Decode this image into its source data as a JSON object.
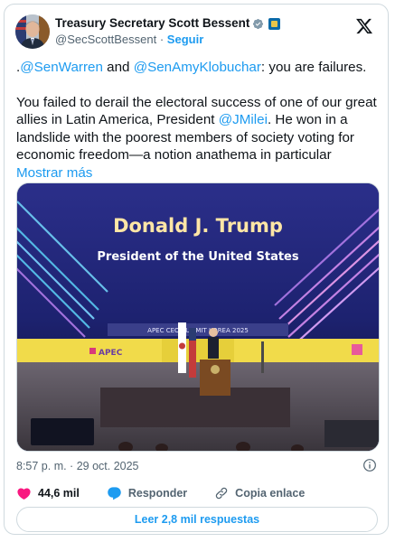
{
  "author": {
    "name": "Treasury Secretary Scott Bessent",
    "handle": "@SecScottBessent",
    "separator": "·",
    "follow_label": "Seguir",
    "verified_color": "#829aab",
    "flag_badge_color": "#0b6aa8"
  },
  "tweet": {
    "line1_prefix": ".",
    "mention1": "@SenWarren",
    "and_text": " and ",
    "mention2": "@SenAmyKlobuchar",
    "line1_suffix": ": you are failures.",
    "para2_text1": "You failed to derail the electoral success of one of our great allies in Latin America, President ",
    "mention3": "@JMilei",
    "para2_text2": ". He won in a landslide with the poorest members of society voting for economic freedom—a notion anathema in particular ",
    "show_more": "Mostrar más"
  },
  "media": {
    "banner_title": "Donald J. Trump",
    "banner_subtitle": "President of the United States",
    "stage_sign": "APEC CEO SUMMIT KOREA 2025",
    "logo_text": "APEC"
  },
  "meta": {
    "timestamp": "8:57 p. m. · 29 oct. 2025"
  },
  "actions": {
    "likes": "44,6 mil",
    "reply_label": "Responder",
    "copy_link_label": "Copia enlace",
    "read_replies_label": "Leer 2,8 mil respuestas"
  },
  "colors": {
    "accent": "#1d9bf0",
    "like_red": "#f91880",
    "muted": "#536471",
    "border": "#cfd9de"
  },
  "icons": [
    "verified-badge-icon",
    "flag-badge-icon",
    "x-logo-icon",
    "info-icon",
    "heart-icon",
    "reply-icon",
    "link-icon"
  ]
}
